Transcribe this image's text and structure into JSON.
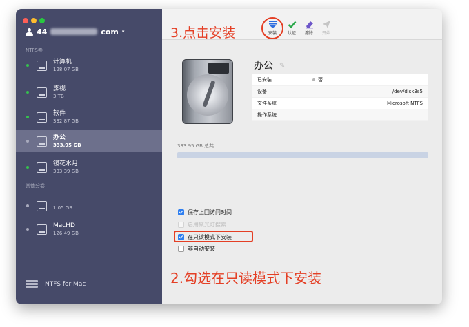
{
  "window": {
    "account_prefix": "44",
    "account_suffix": "com",
    "brand_label": "NTFS for Mac"
  },
  "sidebar": {
    "section_ntfs": "NTFS卷",
    "section_other": "其他分卷",
    "ntfs_volumes": [
      {
        "name": "计算机",
        "size": "128.07 GB"
      },
      {
        "name": "影视",
        "size": "3 TB"
      },
      {
        "name": "软件",
        "size": "332.87 GB"
      },
      {
        "name": "办公",
        "size": "333.95 GB",
        "selected": true
      },
      {
        "name": "镜花水月",
        "size": "333.39 GB"
      }
    ],
    "other_volumes": [
      {
        "name": "",
        "size": "1.05 GB"
      },
      {
        "name": "MacHD",
        "size": "126.49 GB"
      }
    ]
  },
  "toolbar": {
    "annotation": "3.点击安装",
    "buttons": [
      {
        "label": "安装",
        "icon": "mount-icon",
        "enabled": true
      },
      {
        "label": "认证",
        "icon": "checkmark-icon",
        "enabled": true
      },
      {
        "label": "擦除",
        "icon": "eraser-icon",
        "enabled": true
      },
      {
        "label": "开始",
        "icon": "paper-plane-icon",
        "enabled": false
      }
    ]
  },
  "volume": {
    "title": "办公",
    "info": [
      {
        "key": "已安装",
        "value": "否"
      },
      {
        "key": "设备",
        "value": "/dev/disk3s5"
      },
      {
        "key": "文件系统",
        "value": "Microsoft NTFS"
      },
      {
        "key": "操作系统",
        "value": ""
      }
    ],
    "total": "333.95 GB 总共"
  },
  "options": [
    {
      "label": "保存上回访问时间",
      "state": "checked"
    },
    {
      "label": "启用聚光灯搜索",
      "state": "disabled"
    },
    {
      "label": "在只读模式下安装",
      "state": "checked"
    },
    {
      "label": "非自动安装",
      "state": "unchecked"
    }
  ],
  "annotation_bottom": "2.勾选在只读模式下安装",
  "colors": {
    "sidebar": "#464a69",
    "selected_row": "#6d708c",
    "annotation_red": "#e43f25",
    "checkbox_blue": "#2f7ff0"
  }
}
